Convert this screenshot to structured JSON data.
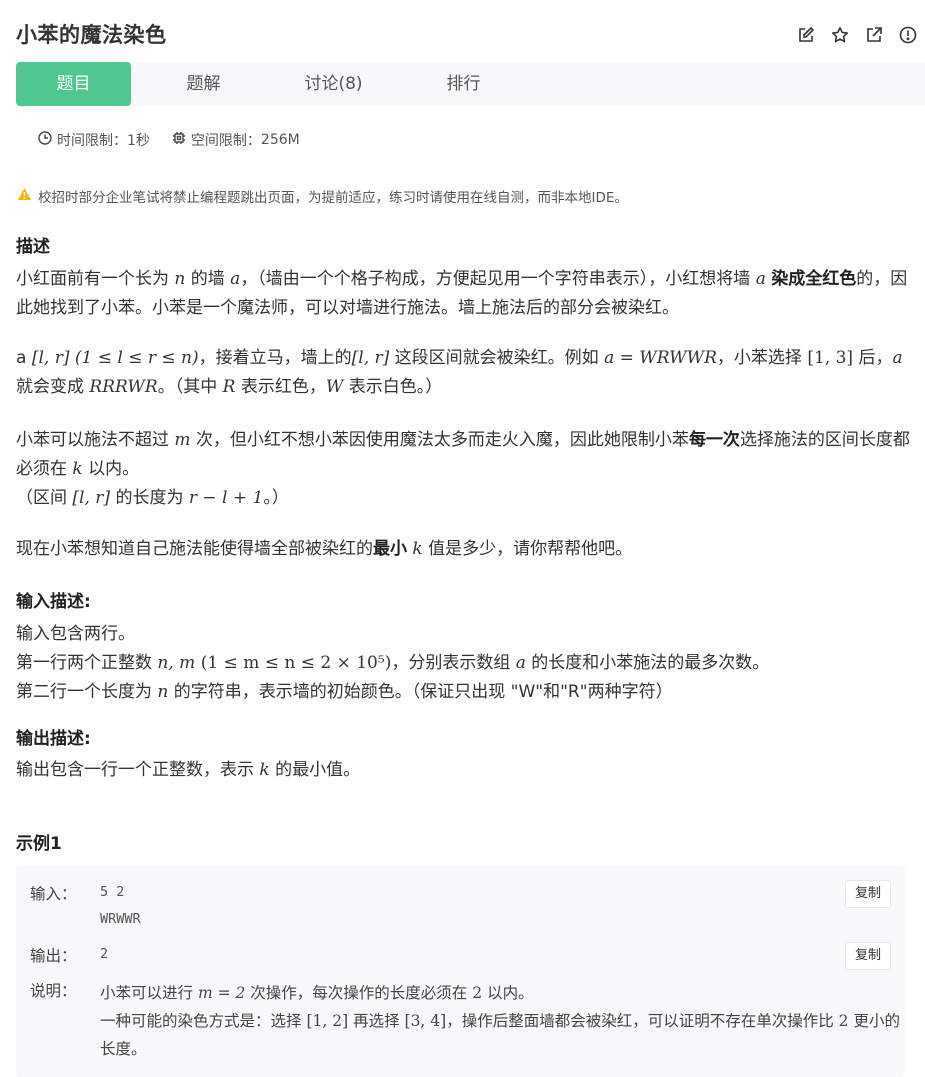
{
  "header": {
    "title": "小苯的魔法染色",
    "icons": [
      "edit-icon",
      "star-icon",
      "external-link-icon",
      "alert-icon"
    ]
  },
  "tabs": [
    {
      "label": "题目",
      "active": true
    },
    {
      "label": "题解",
      "active": false
    },
    {
      "label": "讨论(8)",
      "active": false
    },
    {
      "label": "排行",
      "active": false
    }
  ],
  "limits": {
    "time_label": "时间限制：",
    "time_value": "1秒",
    "space_label": "空间限制：",
    "space_value": "256M"
  },
  "notice": "校招时部分企业笔试将禁止编程题跳出页面，为提前适应，练习时请使用在线自测，而非本地IDE。",
  "description": {
    "heading": "描述",
    "p1_a": "小红面前有一个长为",
    "p1_n": "n",
    "p1_b": "的墙",
    "p1_a2": "a",
    "p1_c": "，（墙由一个个格子构成，方便起见用一个字符串表示），小红想将墙",
    "p1_a3": "a",
    "p1_bold": "染成全红色",
    "p1_d": "的，因此她找到了小苯。小苯是一个魔法师，可以对墙进行施法。墙上施法后的部分会被染红。",
    "p2_a": "a",
    "p2_lr": "[l, r]",
    "p2_cond": "(1 ≤ l ≤ r ≤ n)",
    "p2_b": "，接着立马，墙上的",
    "p2_lr2": "[l, r]",
    "p2_c": "这段区间就会被染红。例如",
    "p2_eq": "a = WRWWR",
    "p2_d": "，小苯选择",
    "p2_13": "[1, 3]",
    "p2_e": "后，",
    "p2_f": "就会变成",
    "p2_res": "RRRWR",
    "p2_g": "。（其中",
    "p2_R": "R",
    "p2_h": "表示红色，",
    "p2_W": "W",
    "p2_i": "表示白色。）",
    "p3_a": "小苯可以施法不超过",
    "p3_m": "m",
    "p3_b": "次，但小红不想小苯因使用魔法太多而走火入魔，因此她限制小苯",
    "p3_bold": "每一次",
    "p3_c": "选择施法的区间长度都必须在",
    "p3_k": "k",
    "p3_d": "以内。",
    "p3_e": "（区间",
    "p3_lr": "[l, r]",
    "p3_f": "的长度为",
    "p3_len": "r − l + 1",
    "p3_g": "。）",
    "p4_a": "现在小苯想知道自己施法能使得墙全部被染红的",
    "p4_bold": "最小",
    "p4_k": "k",
    "p4_b": "值是多少，请你帮帮他吧。"
  },
  "input": {
    "heading": "输入描述:",
    "l1": "输入包含两行。",
    "l2_a": "第一行两个正整数",
    "l2_nm": "n, m",
    "l2_cond": "(1 ≤ m ≤ n ≤ 2 × 10⁵)",
    "l2_b": "，分别表示数组",
    "l2_a2": "a",
    "l2_c": "的长度和小苯施法的最多次数。",
    "l3_a": "第二行一个长度为",
    "l3_n": "n",
    "l3_b": "的字符串，表示墙的初始颜色。（保证只出现 \"W\"和\"R\"两种字符）"
  },
  "output": {
    "heading": "输出描述:",
    "l1_a": "输出包含一行一个正整数，表示",
    "l1_k": "k",
    "l1_b": "的最小值。"
  },
  "example": {
    "heading": "示例1",
    "input_label": "输入：",
    "input_line1": "5 2",
    "input_line2": "WRWWR",
    "output_label": "输出：",
    "output_value": "2",
    "copy_label": "复制",
    "explain_label": "说明：",
    "ex1_a": "小苯可以进行",
    "ex1_m": "m = 2",
    "ex1_b": "次操作，每次操作的长度必须在",
    "ex1_2": "2",
    "ex1_c": "以内。",
    "ex2_a": "一种可能的染色方式是：选择",
    "ex2_12": "[1, 2]",
    "ex2_b": "再选择",
    "ex2_34": "[3, 4]",
    "ex2_c": "，操作后整面墙都会被染红，可以证明不存在单次操作比",
    "ex2_2": "2",
    "ex2_d": "更小的长度。"
  }
}
